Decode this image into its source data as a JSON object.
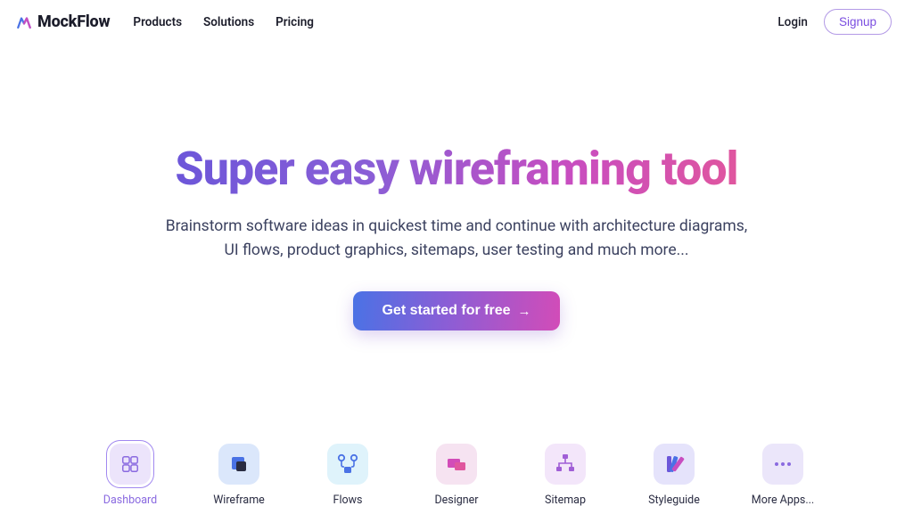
{
  "brand": {
    "name": "MockFlow"
  },
  "nav": {
    "products": "Products",
    "solutions": "Solutions",
    "pricing": "Pricing"
  },
  "auth": {
    "login": "Login",
    "signup": "Signup"
  },
  "hero": {
    "title": "Super easy wireframing tool",
    "subtitle": "Brainstorm software ideas in quickest time and continue with architecture diagrams, UI flows, product graphics, sitemaps, user testing and much more...",
    "cta": "Get started for free"
  },
  "apps": {
    "dashboard": "Dashboard",
    "wireframe": "Wireframe",
    "flows": "Flows",
    "designer": "Designer",
    "sitemap": "Sitemap",
    "styleguide": "Styleguide",
    "more": "More Apps..."
  }
}
